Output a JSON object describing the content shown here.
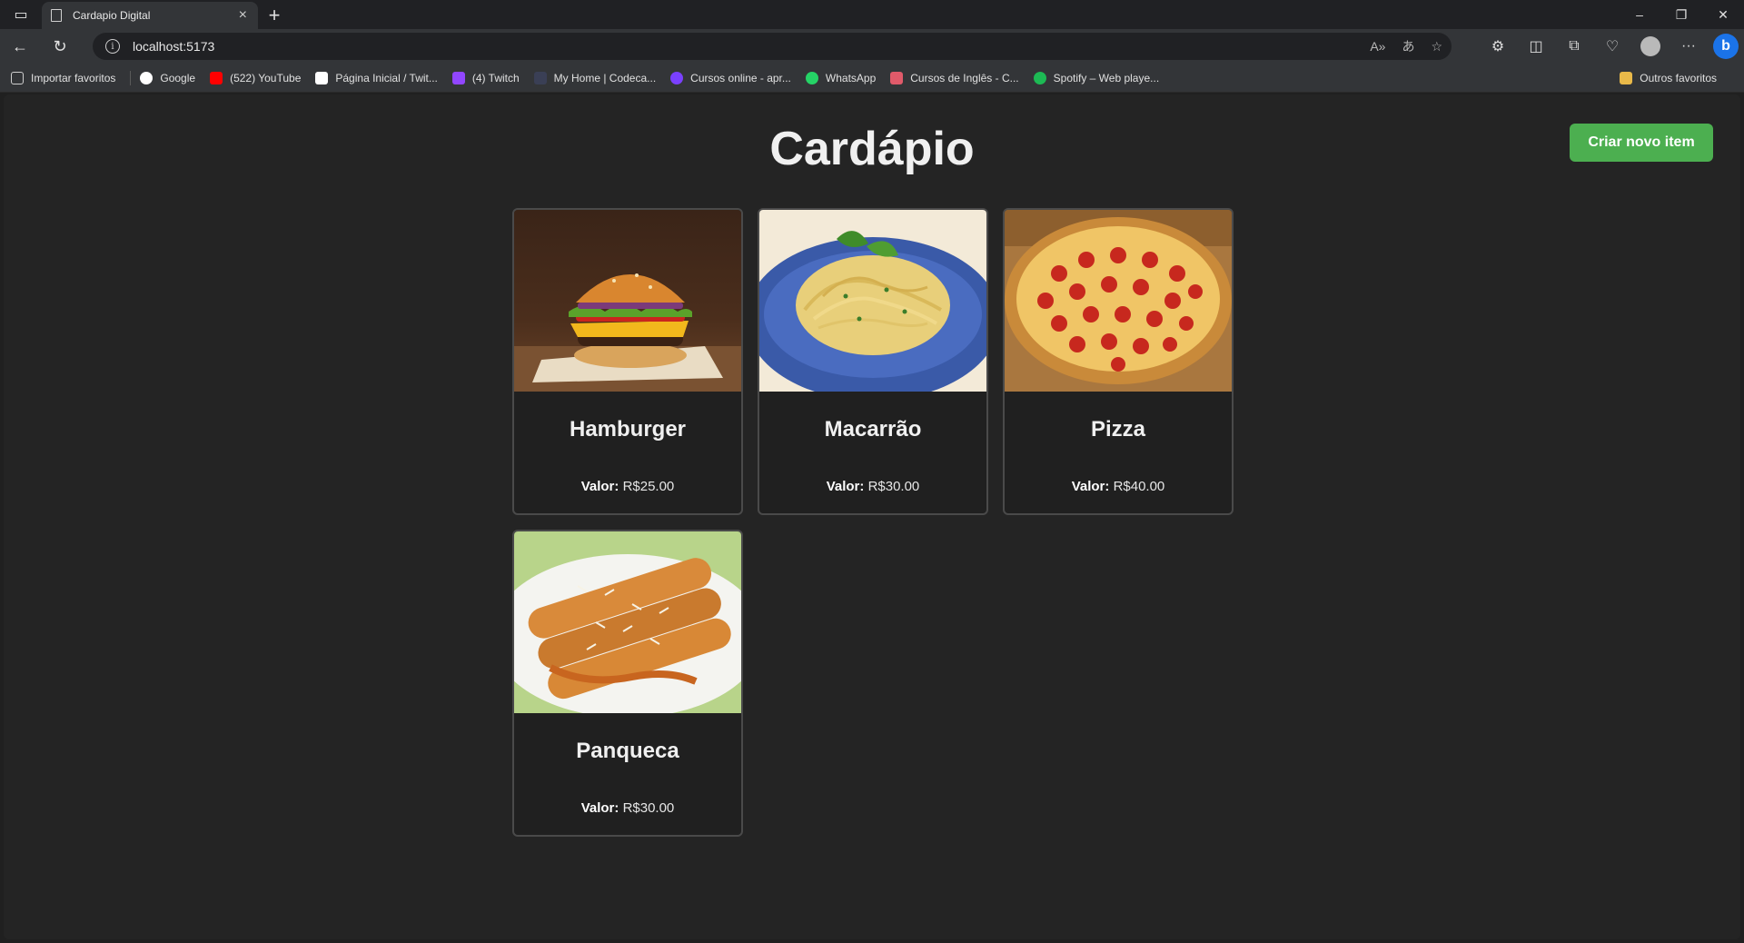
{
  "browser": {
    "tab_title": "Cardapio Digital",
    "url": "localhost:5173",
    "bookmarks": [
      {
        "label": "Importar favoritos",
        "color": "#cfcfcf"
      },
      {
        "label": "Google",
        "color": "#4285f4"
      },
      {
        "label": "(522) YouTube",
        "color": "#ff0000"
      },
      {
        "label": "Página Inicial / Twit...",
        "color": "#ffffff"
      },
      {
        "label": "(4) Twitch",
        "color": "#9146ff"
      },
      {
        "label": "My Home | Codeca...",
        "color": "#3a3f55"
      },
      {
        "label": "Cursos online - apr...",
        "color": "#7a40ff"
      },
      {
        "label": "WhatsApp",
        "color": "#25d366"
      },
      {
        "label": "Cursos de Inglês - C...",
        "color": "#e05a6a"
      },
      {
        "label": "Spotify – Web playe...",
        "color": "#1db954"
      }
    ],
    "other_favorites": "Outros favoritos"
  },
  "page": {
    "title": "Cardápio",
    "create_button": "Criar novo item",
    "price_label": "Valor:"
  },
  "items": [
    {
      "name": "Hamburger",
      "price": "R$25.00",
      "image": "burger"
    },
    {
      "name": "Macarrão",
      "price": "R$30.00",
      "image": "pasta"
    },
    {
      "name": "Pizza",
      "price": "R$40.00",
      "image": "pizza"
    },
    {
      "name": "Panqueca",
      "price": "R$30.00",
      "image": "pancake"
    }
  ]
}
